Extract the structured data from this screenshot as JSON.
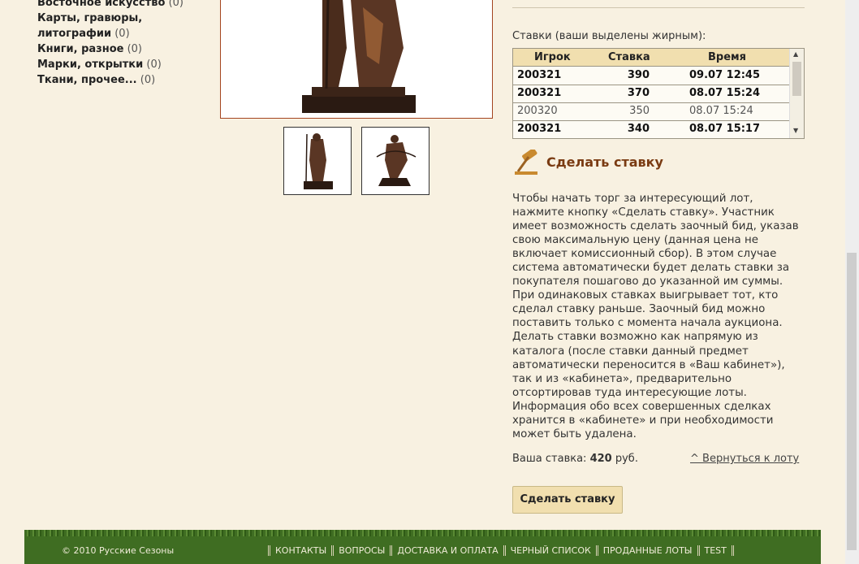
{
  "categories": [
    {
      "name": "Восточное искусство",
      "count": "(0)"
    },
    {
      "name": "Карты, гравюры, литографии",
      "count": "(0)"
    },
    {
      "name": "Книги, разное",
      "count": "(0)"
    },
    {
      "name": "Марки, открытки",
      "count": "(0)"
    },
    {
      "name": "Ткани, прочее...",
      "count": "(0)"
    }
  ],
  "bids": {
    "title": "Ставки (ваши выделены жирным):",
    "headers": {
      "player": "Игрок",
      "bid": "Ставка",
      "time": "Время"
    },
    "rows": [
      {
        "player": "200321",
        "bid": "390",
        "time": "09.07 12:45",
        "mine": true
      },
      {
        "player": "200321",
        "bid": "370",
        "time": "08.07 15:24",
        "mine": true
      },
      {
        "player": "200320",
        "bid": "350",
        "time": "08.07 15:24",
        "mine": false
      },
      {
        "player": "200321",
        "bid": "340",
        "time": "08.07 15:17",
        "mine": true
      }
    ]
  },
  "make_bid": {
    "title": "Сделать ставку",
    "description": "Чтобы начать торг за интересующий лот, нажмите кнопку «Сделать ставку». Участник имеет возможность сделать заочный бид, указав свою максимальную цену (данная цена не включает комиссионный сбор). В этом случае система автоматически будет делать ставки за покупателя пошагово до указанной им суммы. При одинаковых ставках выигрывает тот, кто сделал ставку раньше. Заочный бид можно поставить только с момента начала аукциона. Делать ставки возможно как напрямую из каталога (после ставки данный предмет автоматически переносится в «Ваш кабинет»), так и из «кабинета», предварительно отсортировав туда интересующие лоты. Информация обо всех совершенных сделках хранится в «кабинете» и при необходимости может быть удалена.",
    "your_bid_label": "Ваша ставка:",
    "your_bid_value": "420",
    "currency": "руб.",
    "back_link": "^ Вернуться к лоту",
    "button": "Сделать ставку"
  },
  "footer": {
    "copyright": "© 2010 Русские Сезоны",
    "nav": [
      "КОНТАКТЫ",
      "ВОПРОСЫ",
      "ДОСТАВКА И ОПЛАТА",
      "ЧЕРНЫЙ СПИСОК",
      "ПРОДАННЫЕ ЛОТЫ",
      "TEST"
    ]
  },
  "colors": {
    "bg": "#f8f1e1",
    "accent": "#7a3b12",
    "footer": "#3f6d22",
    "table_head": "#f1dfaf"
  }
}
